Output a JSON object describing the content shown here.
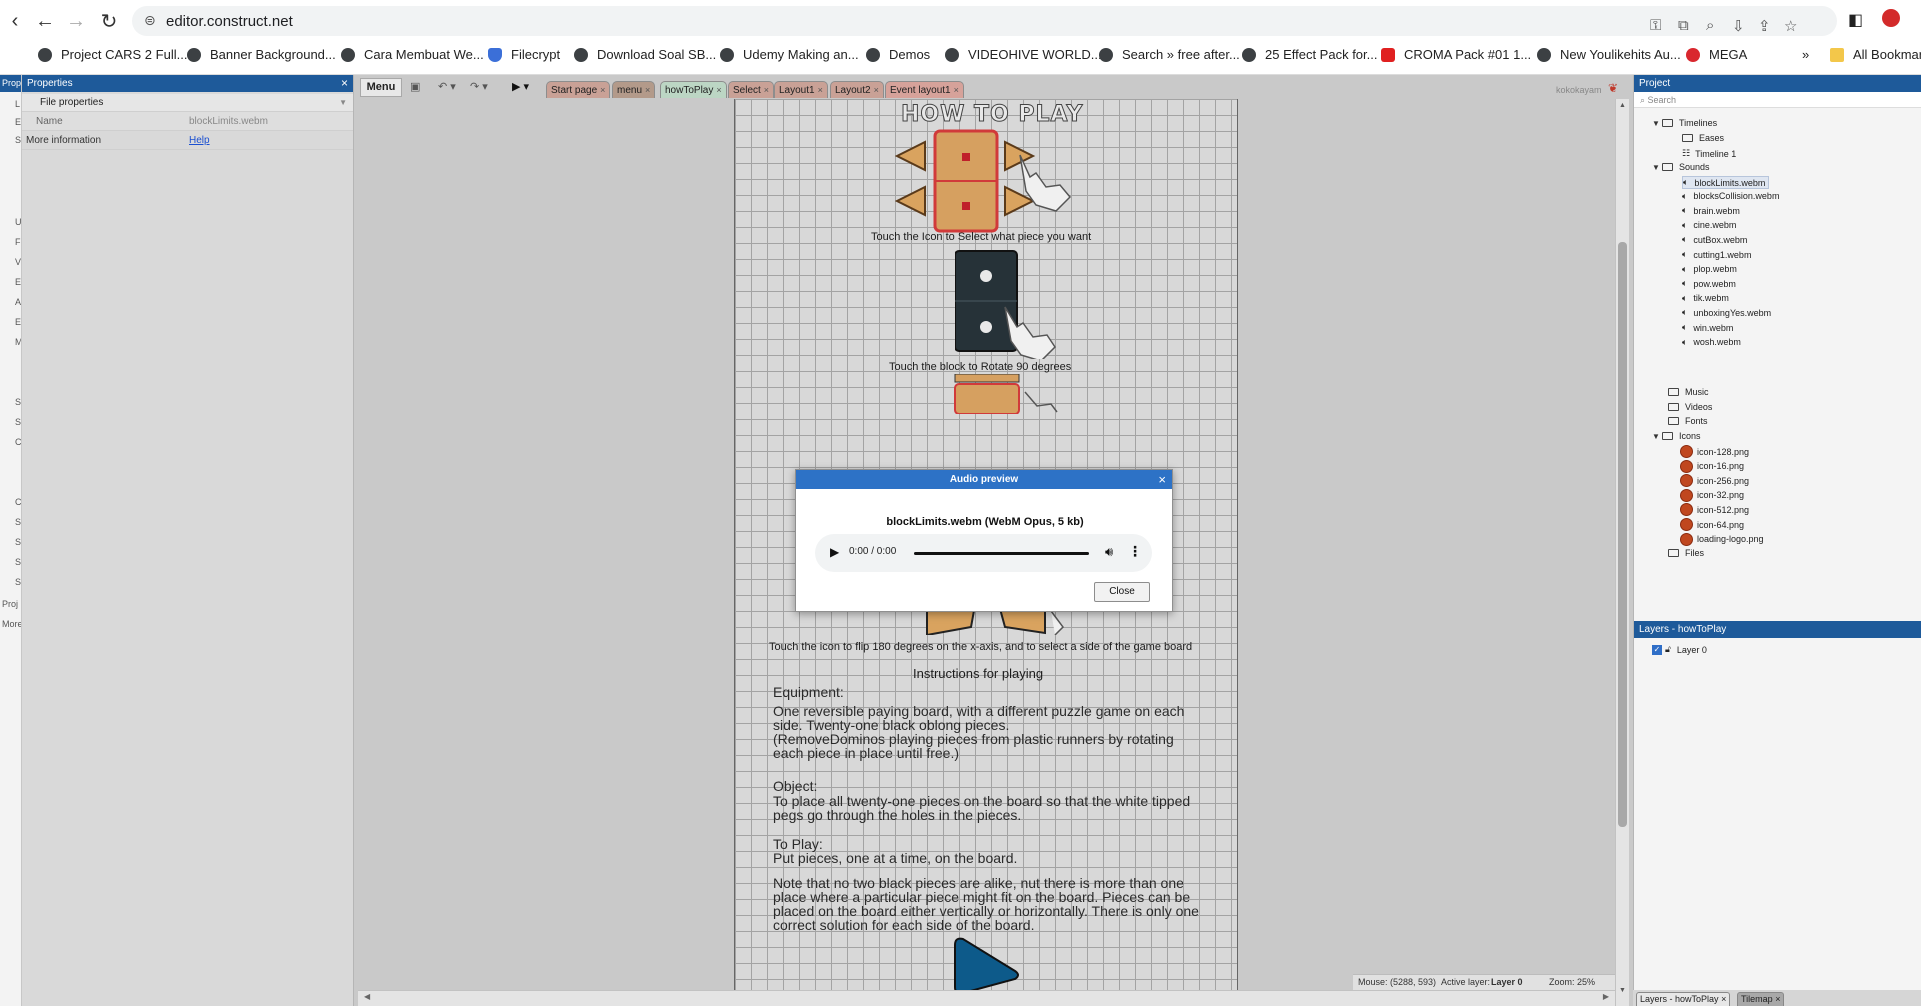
{
  "browser": {
    "url": "editor.construct.net",
    "bookmarks": [
      {
        "label": "Project CARS 2 Full..."
      },
      {
        "label": "Banner Background..."
      },
      {
        "label": "Cara Membuat We..."
      },
      {
        "label": "Filecrypt"
      },
      {
        "label": "Download Soal SB..."
      },
      {
        "label": "Udemy Making an..."
      },
      {
        "label": "Demos"
      },
      {
        "label": "VIDEOHIVE WORLD..."
      },
      {
        "label": "Search » free after..."
      },
      {
        "label": "25 Effect Pack for..."
      },
      {
        "label": "CROMA Pack #01 1..."
      },
      {
        "label": "New Youlikehits Au..."
      },
      {
        "label": "MEGA"
      }
    ],
    "more_bookmarks": "»",
    "all_bookmarks": "All Bookmarks"
  },
  "left_strip": {
    "header": "Prop",
    "footer_a": "Proj",
    "footer_b": "More"
  },
  "properties": {
    "title": "Properties",
    "group": "File properties",
    "rows": [
      {
        "key": "Name",
        "value": "blockLimits.webm"
      }
    ],
    "more_info_label": "More information",
    "more_info_link": "Help"
  },
  "toolbar": {
    "menu": "Menu",
    "tabs": [
      {
        "label": "Start page",
        "color": "#c9a196"
      },
      {
        "label": "menu",
        "color": "#b39a8a"
      },
      {
        "label": "howToPlay",
        "color": "#bcd6c4"
      },
      {
        "label": "Select",
        "color": "#c9a196"
      },
      {
        "label": "Layout1",
        "color": "#c9a196"
      },
      {
        "label": "Layout2",
        "color": "#c9a196"
      },
      {
        "label": "Event layout1",
        "color": "#d6a29a"
      }
    ],
    "user": "kokokayam"
  },
  "layout": {
    "title": "HOW TO PLAY",
    "caption1": "Touch the Icon to Select what piece you want",
    "caption2": "Touch the block to Rotate 90 degrees",
    "caption3": "Touch the icon to flip 180 degrees on the x-axis, and to select a side of the game board",
    "instructions_heading": "Instructions for playing",
    "equipment_label": "Equipment:",
    "equipment_text": "One reversible paying board, with a different puzzle game on each\nside. Twenty-one black oblong pieces.\n(RemoveDominos playing pieces from plastic runners by rotating\neach piece in place until free.)",
    "object_label": "Object:",
    "object_text": "To place all twenty-one pieces on the board so that the white tipped\npegs go through the holes in the pieces.",
    "toplay_label": "To Play:",
    "toplay_text": "Put pieces, one at a time, on the board.",
    "note_text": "Note that no two black pieces are alike, nut there is more than one\nplace where a particular piece might fit on the board. Pieces can be\nplaced on the board either vertically or horizontally. There is only one\ncorrect solution for each side of the board."
  },
  "status": {
    "mouse": "Mouse: (5288, 593)",
    "active_layer_label": "Active layer:",
    "active_layer": "Layer 0",
    "zoom": "Zoom: 25%"
  },
  "project": {
    "title": "Project",
    "search_placeholder": "Search",
    "timelines": "Timelines",
    "eases": "Eases",
    "timeline1": "Timeline 1",
    "sounds": "Sounds",
    "sound_files": [
      "blockLimits.webm",
      "blocksCollision.webm",
      "brain.webm",
      "cine.webm",
      "cutBox.webm",
      "cutting1.webm",
      "plop.webm",
      "pow.webm",
      "tik.webm",
      "unboxingYes.webm",
      "win.webm",
      "wosh.webm"
    ],
    "music": "Music",
    "videos": "Videos",
    "fonts": "Fonts",
    "icons": "Icons",
    "icon_files": [
      "icon-128.png",
      "icon-16.png",
      "icon-256.png",
      "icon-32.png",
      "icon-512.png",
      "icon-64.png",
      "loading-logo.png"
    ],
    "files": "Files"
  },
  "layers": {
    "title": "Layers - howToPlay",
    "layer0": "Layer 0"
  },
  "right_tabs": {
    "layers": "Layers - howToPlay",
    "tilemap": "Tilemap"
  },
  "dialog": {
    "title": "Audio preview",
    "file": "blockLimits.webm (WebM Opus, 5 kb)",
    "time": "0:00 / 0:00",
    "close": "Close"
  },
  "colors": {
    "accent": "#1e5a9a",
    "dialog_header": "#2d72c6",
    "piece_orange": "#d9a35f",
    "piece_dark": "#263238",
    "piece_blue": "#0d5a8a"
  }
}
